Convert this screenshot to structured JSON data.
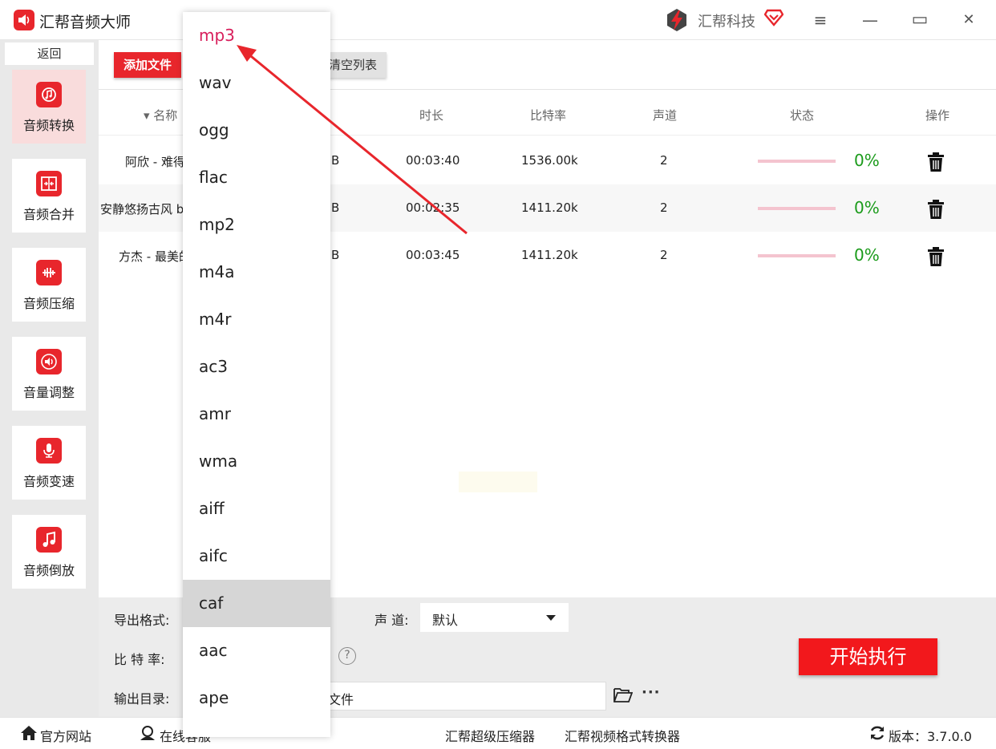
{
  "app": {
    "title": "汇帮音频大师",
    "brand": "汇帮科技",
    "accent": "#e8262c"
  },
  "window": {
    "menu": "≡",
    "minimize": "—",
    "maximize": "▭",
    "close": "✕"
  },
  "sidebar": {
    "back": "返回",
    "items": [
      {
        "label": "音频转换",
        "icon": "music-convert-icon"
      },
      {
        "label": "音频合并",
        "icon": "merge-icon"
      },
      {
        "label": "音频压缩",
        "icon": "compress-icon"
      },
      {
        "label": "音量调整",
        "icon": "volume-icon"
      },
      {
        "label": "音频变速",
        "icon": "microphone-icon"
      },
      {
        "label": "音频倒放",
        "icon": "music-note-icon"
      }
    ]
  },
  "toolbar": {
    "add_file": "添加文件",
    "clear_list": "清空列表"
  },
  "table": {
    "headers": {
      "name": "▾ 名称",
      "duration": "时长",
      "bitrate": "比特率",
      "channels": "声道",
      "status": "状态",
      "action": "操作"
    },
    "rows": [
      {
        "name": "阿欣 - 难得",
        "size": "B",
        "duration": "00:03:40",
        "bitrate": "1536.00k",
        "channels": "2",
        "progress": "0%"
      },
      {
        "name": "安静悠扬古风 b",
        "size": "B",
        "duration": "00:02:35",
        "bitrate": "1411.20k",
        "channels": "2",
        "progress": "0%"
      },
      {
        "name": "方杰 - 最美的",
        "size": "B",
        "duration": "00:03:45",
        "bitrate": "1411.20k",
        "channels": "2",
        "progress": "0%"
      }
    ]
  },
  "settings": {
    "format_label": "导出格式:",
    "channel_label": "声 道:",
    "channel_value": "默认",
    "bitrate_label": "比 特 率:",
    "help": "?",
    "output_label": "输出目录:",
    "output_value": "文件",
    "more": "···",
    "start": "开始执行"
  },
  "footer": {
    "website": "官方网站",
    "online": "在线客服",
    "compressor": "汇帮超级压缩器",
    "video_converter": "汇帮视频格式转换器",
    "version": "版本：3.7.0.0"
  },
  "dropdown": {
    "options": [
      "mp3",
      "wav",
      "ogg",
      "flac",
      "mp2",
      "m4a",
      "m4r",
      "ac3",
      "amr",
      "wma",
      "aiff",
      "aifc",
      "caf",
      "aac",
      "ape"
    ],
    "selected": "mp3",
    "hovered": "caf"
  }
}
